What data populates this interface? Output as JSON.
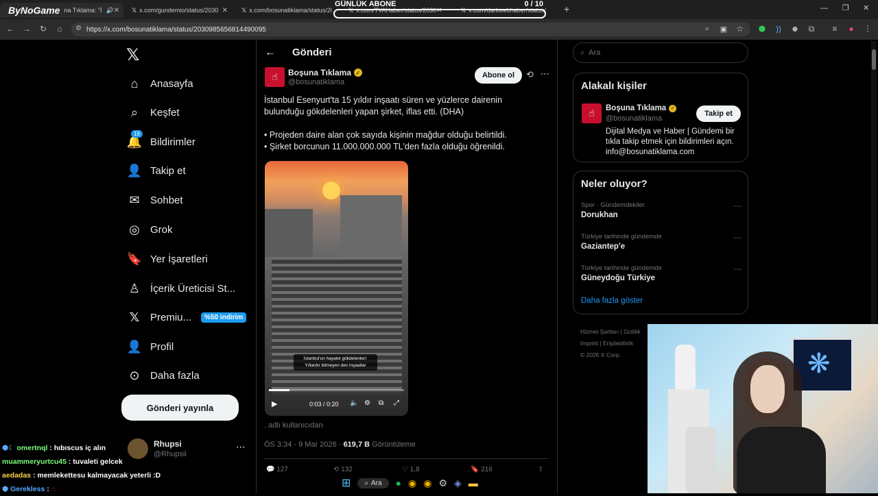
{
  "overlay": {
    "brand": "ByNoGame",
    "goal_label": "GÜNLÜK ABONE",
    "goal_count": "0 / 10"
  },
  "browser": {
    "tabs": [
      {
        "title": "na Tıklama: \"İ"
      },
      {
        "title": "x.com/gundemio/status/2030"
      },
      {
        "title": "x.com/bosunatiklama/status/20"
      },
      {
        "title": "x.com/TVAHaber/status/2030"
      },
      {
        "title": "x.com/darkwebhaber/status/"
      }
    ],
    "url": "https://x.com/bosunatiklama/status/2030985656814490095"
  },
  "nav": {
    "items": [
      {
        "label": "Anasayfa",
        "icon": "home-icon"
      },
      {
        "label": "Keşfet",
        "icon": "search-icon"
      },
      {
        "label": "Bildirimler",
        "icon": "bell-icon",
        "badge": "19"
      },
      {
        "label": "Takip et",
        "icon": "add-user-icon"
      },
      {
        "label": "Sohbet",
        "icon": "mail-icon"
      },
      {
        "label": "Grok",
        "icon": "grok-icon"
      },
      {
        "label": "Yer İşaretleri",
        "icon": "bookmark-icon"
      },
      {
        "label": "İçerik Üreticisi St...",
        "icon": "creator-icon"
      },
      {
        "label": "Premiu...",
        "icon": "x-icon",
        "badge": "%50 indirim"
      },
      {
        "label": "Profil",
        "icon": "profile-icon"
      },
      {
        "label": "Daha fazla",
        "icon": "more-circle-icon"
      }
    ],
    "post_button": "Gönderi yayınla",
    "account": {
      "name": "Rhupsi",
      "handle": "@Rhupsii"
    }
  },
  "post": {
    "header_title": "Gönderi",
    "author_name": "Boşuna Tıklama",
    "author_handle": "@bosunatiklama",
    "subscribe_label": "Abone ol",
    "text_line1": "İstanbul Esenyurt'ta 15 yıldır inşaatı süren ve yüzlerce dairenin",
    "text_line2": "bulunduğu gökdelenleri yapan şirket, iflas etti. (DHA)",
    "bullet1": "• Projeden daire alan çok sayıda kişinin mağdur olduğu belirtildi.",
    "bullet2": "• Şirket borcunun 11.000.000.000 TL'den fazla olduğu öğrenildi.",
    "video_caption_1": "İstanbul'un hayalet gökdelenleri:",
    "video_caption_2": "Yıllardır bitmeyen dev inşaatlar",
    "video_time": "0:03 / 0:20",
    "video_progress": 0.15,
    "attribution": ". adlı kullanıcıdan",
    "timestamp": "ÖS 3:34 · 9 Mar 2026 · ",
    "views": "619,7 B",
    "views_label": " Görüntüleme",
    "stats": [
      "127",
      "132",
      "1,8",
      "216"
    ]
  },
  "right": {
    "search_placeholder": "Ara",
    "related_title": "Alakalı kişiler",
    "related": {
      "name": "Boşuna Tıklama",
      "handle": "@bosunatiklama",
      "follow_label": "Takip et",
      "bio1": "Dijital Medya ve Haber | Gündemi bir",
      "bio2": "tıkla takip etmek için bildirimleri açın.",
      "bio3": "info@bosunatiklama.com"
    },
    "trends_title": "Neler oluyor?",
    "trends": [
      {
        "context": "Spor · Gündemdekiler",
        "topic": "Dorukhan"
      },
      {
        "context": "Türkiye tarihinde gündemde",
        "topic": "Gaziantep'e"
      },
      {
        "context": "Türkiye tarihinde gündemde",
        "topic": "Güneydoğu Türkiye"
      }
    ],
    "show_more": "Daha fazla göster",
    "footer": [
      "Hizmet Şartları",
      "Gizlilik",
      "Imprint",
      "Erişilebilirlik",
      "© 2026 X Corp."
    ]
  },
  "chat": [
    {
      "user": "omertnql",
      "msg": " : hıbıscus iç alın",
      "color": "#7dff7d"
    },
    {
      "user": "muammeryurtcu45",
      "msg": " : tuvaleti gelcek",
      "color": "#7dff7d"
    },
    {
      "user": "aedadas",
      "msg": " : memlekettesu kalmayacak yeterli :D",
      "color": "#ffd24a"
    },
    {
      "user": "Gerekless",
      "msg": " : ",
      "color": "#5aa9ff"
    }
  ],
  "taskbar": {
    "search_label": "Ara"
  }
}
